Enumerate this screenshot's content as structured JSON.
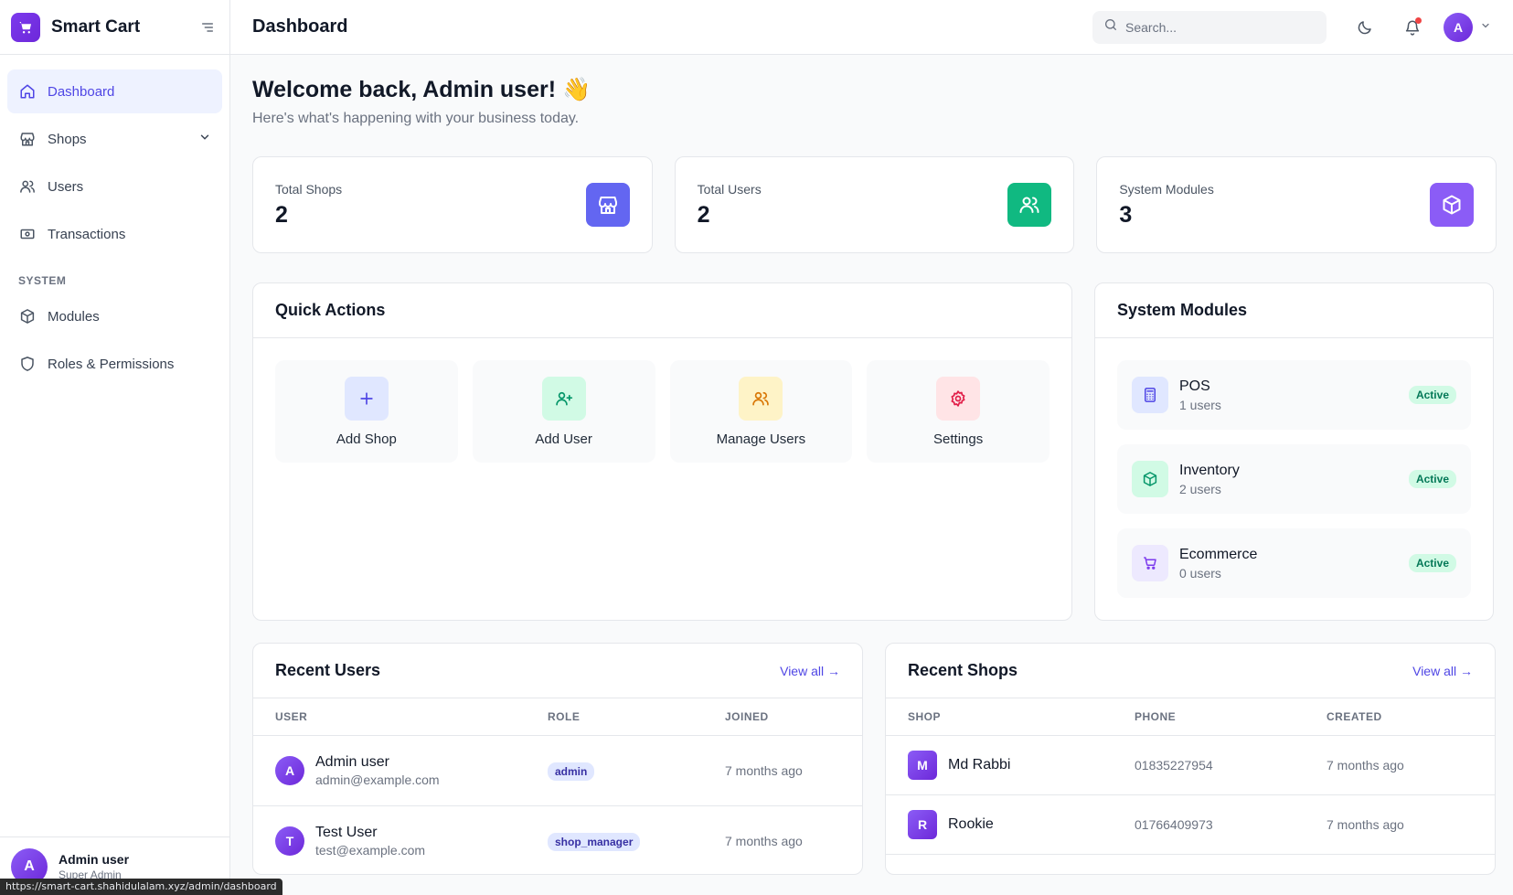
{
  "brand": {
    "name": "Smart Cart"
  },
  "sidebar": {
    "items": [
      {
        "label": "Dashboard",
        "icon": "home-icon",
        "active": true
      },
      {
        "label": "Shops",
        "icon": "store-icon"
      },
      {
        "label": "Users",
        "icon": "users-icon"
      },
      {
        "label": "Transactions",
        "icon": "banknote-icon"
      }
    ],
    "section_label": "SYSTEM",
    "system_items": [
      {
        "label": "Modules",
        "icon": "cube-icon"
      },
      {
        "label": "Roles & Permissions",
        "icon": "shield-icon"
      }
    ],
    "user": {
      "initial": "A",
      "name": "Admin user",
      "role": "Super Admin"
    }
  },
  "status_url": "https://smart-cart.shahidulalam.xyz/admin/dashboard",
  "header": {
    "title": "Dashboard",
    "search_placeholder": "Search...",
    "avatar_initial": "A"
  },
  "welcome": {
    "title": "Welcome back, Admin user! 👋",
    "subtitle": "Here's what's happening with your business today."
  },
  "stats": [
    {
      "label": "Total Shops",
      "value": "2",
      "color": "#6366f1"
    },
    {
      "label": "Total Users",
      "value": "2",
      "color": "#10b981"
    },
    {
      "label": "System Modules",
      "value": "3",
      "color": "#8b5cf6"
    }
  ],
  "quick_actions": {
    "title": "Quick Actions",
    "items": [
      {
        "label": "Add Shop",
        "icon": "plus-icon"
      },
      {
        "label": "Add User",
        "icon": "user-plus-icon"
      },
      {
        "label": "Manage Users",
        "icon": "users-icon"
      },
      {
        "label": "Settings",
        "icon": "gear-icon"
      }
    ]
  },
  "system_modules": {
    "title": "System Modules",
    "items": [
      {
        "name": "POS",
        "users": "1 users",
        "status": "Active",
        "icon": "calculator-icon"
      },
      {
        "name": "Inventory",
        "users": "2 users",
        "status": "Active",
        "icon": "cube-icon"
      },
      {
        "name": "Ecommerce",
        "users": "0 users",
        "status": "Active",
        "icon": "cart-icon"
      }
    ]
  },
  "recent_users": {
    "title": "Recent Users",
    "view_all": "View all →",
    "columns": [
      "USER",
      "ROLE",
      "JOINED"
    ],
    "rows": [
      {
        "initial": "A",
        "name": "Admin user",
        "email": "admin@example.com",
        "role": "admin",
        "joined": "7 months ago"
      },
      {
        "initial": "T",
        "name": "Test User",
        "email": "test@example.com",
        "role": "shop_manager",
        "joined": "7 months ago"
      }
    ]
  },
  "recent_shops": {
    "title": "Recent Shops",
    "view_all": "View all →",
    "columns": [
      "SHOP",
      "PHONE",
      "CREATED"
    ],
    "rows": [
      {
        "initial": "M",
        "name": "Md Rabbi",
        "phone": "01835227954",
        "created": "7 months ago"
      },
      {
        "initial": "R",
        "name": "Rookie",
        "phone": "01766409973",
        "created": "7 months ago"
      }
    ]
  }
}
